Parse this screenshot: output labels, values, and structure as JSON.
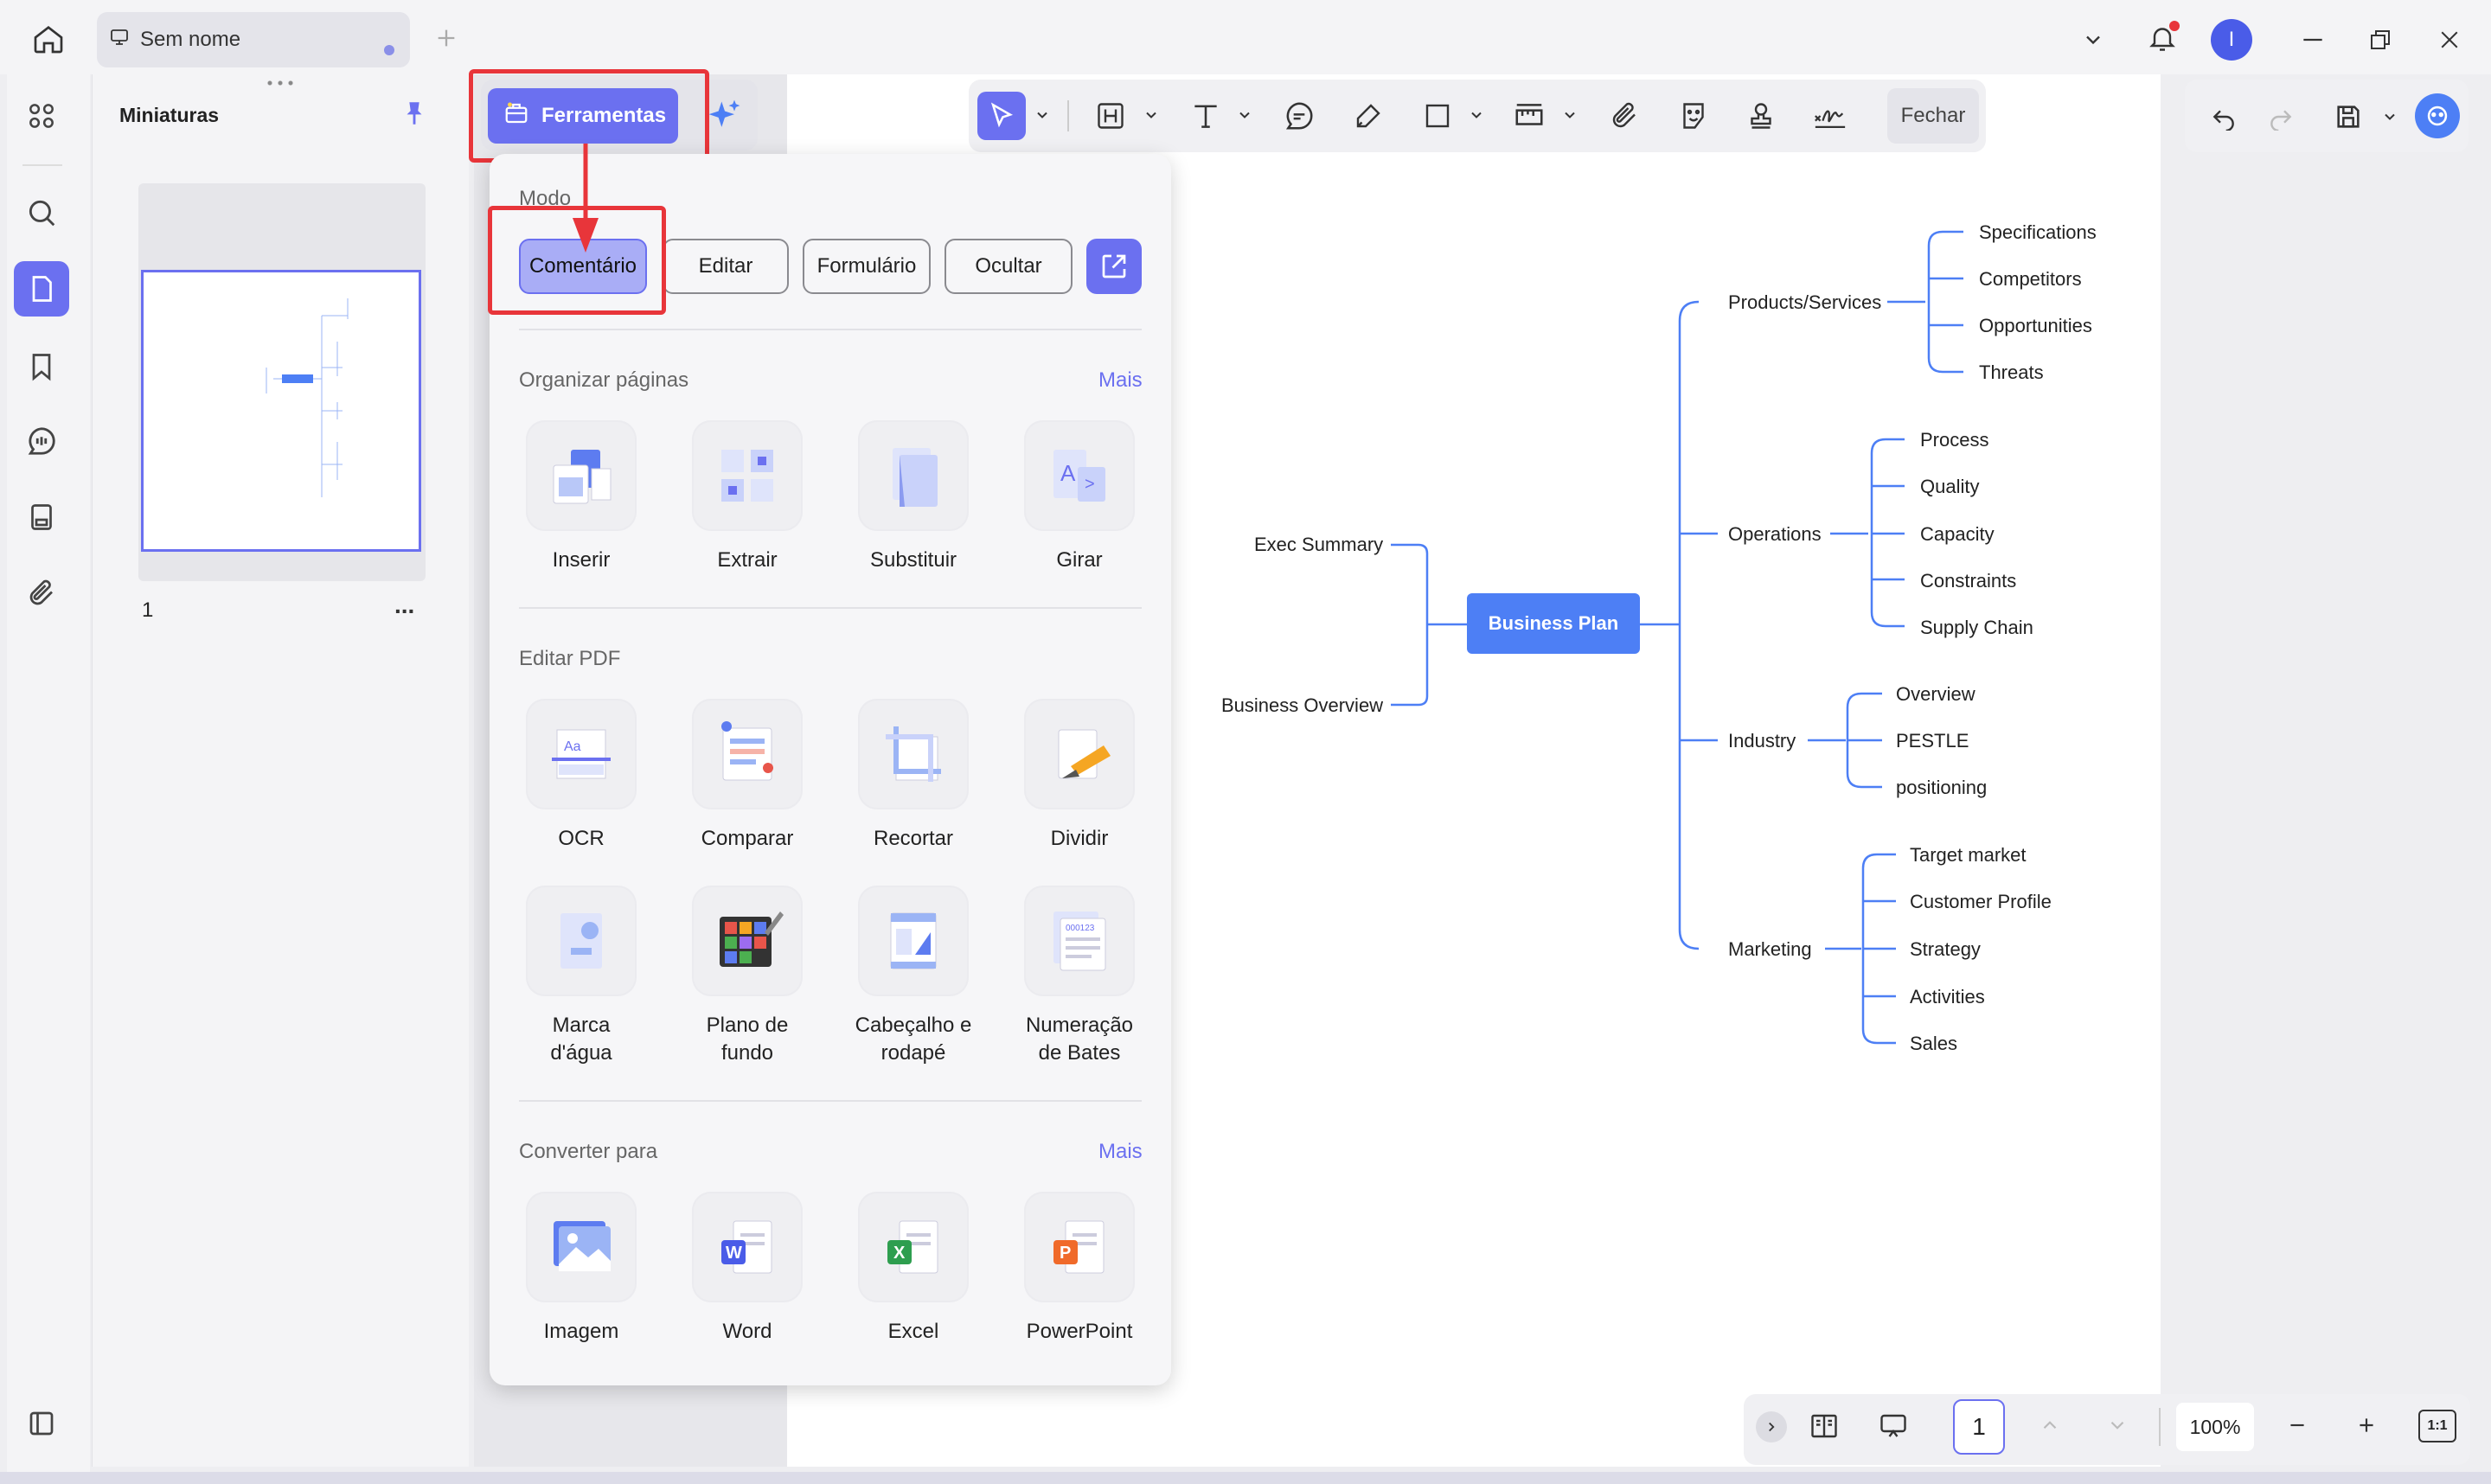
{
  "app": {
    "tab_title": "Sem nome",
    "user_initial": "I"
  },
  "thumbnails": {
    "title": "Miniaturas",
    "page_number": "1",
    "more": "..."
  },
  "toolbar": {
    "tools_button": "Ferramentas",
    "close_button": "Fechar"
  },
  "panel": {
    "mode_label": "Modo",
    "modes": [
      "Comentário",
      "Editar",
      "Formulário",
      "Ocultar"
    ],
    "organize": {
      "label": "Organizar páginas",
      "more": "Mais",
      "items": [
        "Inserir",
        "Extrair",
        "Substituir",
        "Girar"
      ]
    },
    "edit_pdf": {
      "label": "Editar PDF",
      "items": [
        "OCR",
        "Comparar",
        "Recortar",
        "Dividir",
        "Marca d'água",
        "Plano de fundo",
        "Cabeçalho e rodapé",
        "Numeração de Bates"
      ]
    },
    "convert": {
      "label": "Converter para",
      "more": "Mais",
      "items": [
        "Imagem",
        "Word",
        "Excel",
        "PowerPoint"
      ]
    }
  },
  "mindmap": {
    "root": "Business Plan",
    "left": [
      "Exec Summary",
      "Business Overview"
    ],
    "branches": [
      {
        "name": "Products/Services",
        "children": [
          "Specifications",
          "Competitors",
          "Opportunities",
          "Threats"
        ]
      },
      {
        "name": "Operations",
        "children": [
          "Process",
          "Quality",
          "Capacity",
          "Constraints",
          "Supply Chain"
        ]
      },
      {
        "name": "Industry",
        "children": [
          "Overview",
          "PESTLE",
          "positioning"
        ]
      },
      {
        "name": "Marketing",
        "children": [
          "Target market",
          "Customer Profile",
          "Strategy",
          "Activities",
          "Sales"
        ]
      }
    ]
  },
  "status": {
    "page": "1",
    "zoom": "100%",
    "fit": "1:1"
  },
  "colors": {
    "accent": "#6b70f0",
    "mindmap": "#4d7ff5",
    "highlight": "#e8353a"
  }
}
